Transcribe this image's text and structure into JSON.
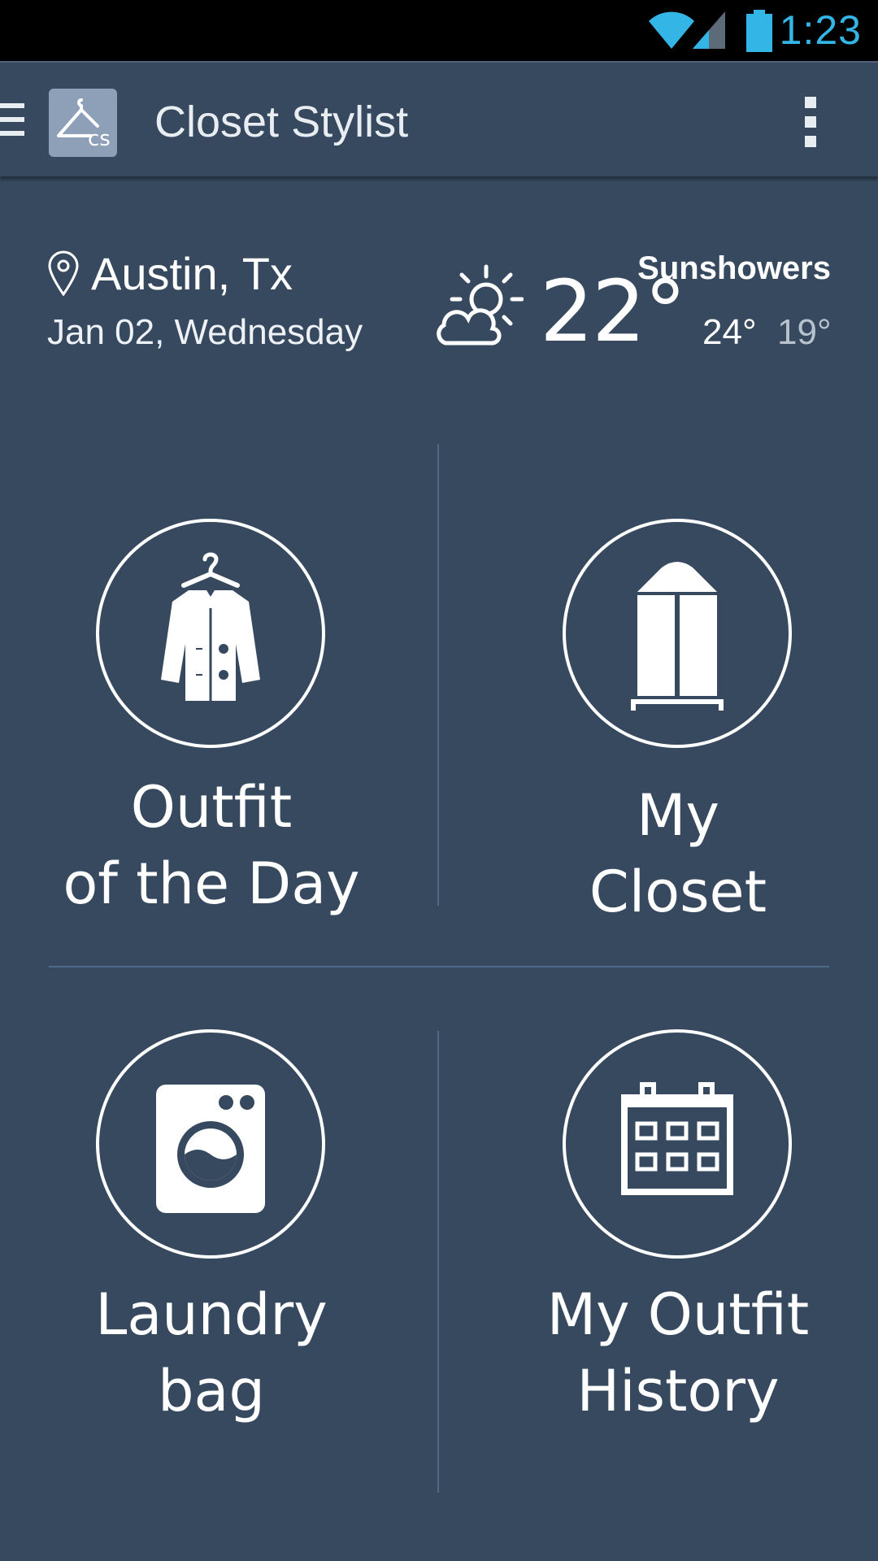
{
  "status_bar": {
    "time": "1:23",
    "icons": [
      "wifi-icon",
      "signal-icon",
      "battery-icon"
    ],
    "accent_color": "#33b5e5"
  },
  "app_bar": {
    "title": "Closet Stylist",
    "icons": [
      "menu-icon",
      "app-logo",
      "overflow-menu-icon"
    ]
  },
  "weather": {
    "location": "Austin, Tx",
    "date": "Jan 02, Wednesday",
    "temperature": "22°",
    "condition": "Sunshowers",
    "high": "24°",
    "low": "19°",
    "icon": "partly-cloudy-sun-icon"
  },
  "tiles": [
    {
      "line1": "Outfit",
      "line2": "of the Day",
      "icon": "jacket-hanger-icon"
    },
    {
      "line1": "My",
      "line2": "Closet",
      "icon": "wardrobe-icon"
    },
    {
      "line1": "Laundry",
      "line2": "bag",
      "icon": "washing-machine-icon"
    },
    {
      "line1": "My Outfit",
      "line2": "History",
      "icon": "calendar-icon"
    }
  ],
  "colors": {
    "background": "#36495f",
    "divider": "#4f6a88",
    "low_temp": "#b8c2cc"
  }
}
